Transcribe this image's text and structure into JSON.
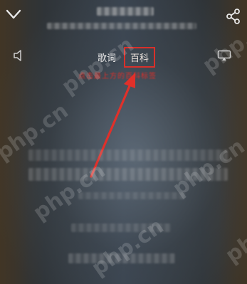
{
  "tabs": [
    {
      "label": "歌词",
      "active": false
    },
    {
      "label": "百科",
      "active": true
    }
  ],
  "annotation": {
    "text": "点击最上方的百科标签",
    "color": "#d9302a"
  },
  "watermark": {
    "text": "php.cn"
  },
  "icons": [
    "back-chevron-icon",
    "share-icon",
    "speaker-icon",
    "cast-icon",
    "red-arrow"
  ],
  "colors": {
    "highlight": "#d9302a",
    "text": "#e6e6e6"
  }
}
